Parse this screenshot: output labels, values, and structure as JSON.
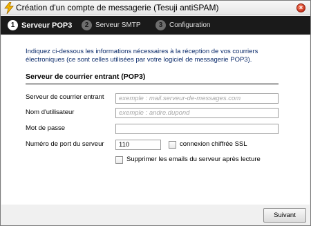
{
  "window": {
    "title": "Création d'un compte de messagerie (Tesuji antiSPAM)",
    "close_glyph": "×"
  },
  "steps": [
    {
      "number": "1",
      "label": "Serveur POP3",
      "active": true
    },
    {
      "number": "2",
      "label": "Serveur SMTP",
      "active": false
    },
    {
      "number": "3",
      "label": "Configuration",
      "active": false
    }
  ],
  "intro": {
    "text": "Indiquez ci-dessous les informations nécessaires à la réception de vos courriers électroniques (ce sont celles utilisées par votre logiciel de messagerie POP3)."
  },
  "section": {
    "title": "Serveur de courrier entrant (POP3)"
  },
  "fields": {
    "server": {
      "label": "Serveur de courrier entrant",
      "value": "",
      "placeholder": "exemple : mail.serveur-de-messages.com"
    },
    "username": {
      "label": "Nom d'utilisateur",
      "value": "",
      "placeholder": "exemple : andre.dupond"
    },
    "password": {
      "label": "Mot de passe",
      "value": "",
      "placeholder": ""
    },
    "port": {
      "label": "Numéro de port du serveur",
      "value": "110"
    }
  },
  "checkboxes": {
    "ssl": {
      "label": "connexion chiffrée SSL",
      "checked": false
    },
    "delete_after": {
      "label": "Supprimer les emails du serveur après lecture",
      "checked": false
    }
  },
  "footer": {
    "next_label": "Suivant"
  },
  "colors": {
    "stepbar_bg": "#1a1a1a",
    "intro_text": "#0a2a6a",
    "placeholder_text": "#a8a8a8"
  },
  "icons": {
    "app": "lightning-icon",
    "close": "close-icon"
  }
}
